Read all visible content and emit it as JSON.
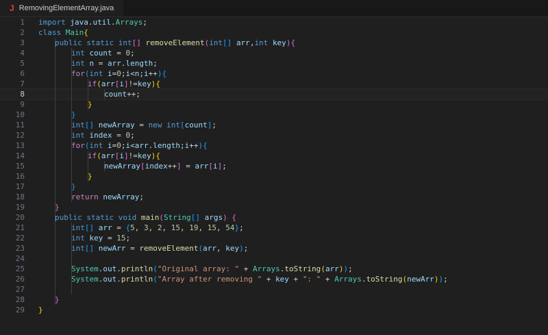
{
  "tab": {
    "icon": "java-icon",
    "label": "RemovingElementArray.java"
  },
  "active_line": 8,
  "colors": {
    "keyword": "#569cd6",
    "control": "#c586c0",
    "type": "#4ec9b0",
    "function": "#dcdcaa",
    "variable": "#9cdcfe",
    "number": "#b5cea8",
    "string": "#ce9178",
    "bracket1": "#ffd700",
    "bracket2": "#da70d6",
    "bracket3": "#179fff"
  },
  "lines": [
    {
      "n": "1",
      "ind": 0,
      "t": [
        [
          "kw",
          "import "
        ],
        [
          "var",
          "java"
        ],
        [
          "pl",
          "."
        ],
        [
          "var",
          "util"
        ],
        [
          "pl",
          "."
        ],
        [
          "ty",
          "Arrays"
        ],
        [
          "pl",
          ";"
        ]
      ]
    },
    {
      "n": "2",
      "ind": 0,
      "t": [
        [
          "kw",
          "class "
        ],
        [
          "ty",
          "Main"
        ],
        [
          "b1",
          "{"
        ]
      ]
    },
    {
      "n": "3",
      "ind": 1,
      "t": [
        [
          "kw",
          "public static int"
        ],
        [
          "b2",
          "[]"
        ],
        [
          "pl",
          " "
        ],
        [
          "fn",
          "removeElement"
        ],
        [
          "b2",
          "("
        ],
        [
          "kw",
          "int"
        ],
        [
          "b3",
          "[]"
        ],
        [
          "pl",
          " "
        ],
        [
          "var",
          "arr"
        ],
        [
          "pl",
          ","
        ],
        [
          "kw",
          "int"
        ],
        [
          "pl",
          " "
        ],
        [
          "var",
          "key"
        ],
        [
          "b2",
          ")"
        ],
        [
          "b2",
          "{"
        ]
      ]
    },
    {
      "n": "4",
      "ind": 2,
      "t": [
        [
          "kw",
          "int"
        ],
        [
          "pl",
          " "
        ],
        [
          "var",
          "count"
        ],
        [
          "pl",
          " = "
        ],
        [
          "num",
          "0"
        ],
        [
          "pl",
          ";"
        ]
      ]
    },
    {
      "n": "5",
      "ind": 2,
      "t": [
        [
          "kw",
          "int"
        ],
        [
          "pl",
          " "
        ],
        [
          "var",
          "n"
        ],
        [
          "pl",
          " = "
        ],
        [
          "var",
          "arr"
        ],
        [
          "pl",
          "."
        ],
        [
          "var",
          "length"
        ],
        [
          "pl",
          ";"
        ]
      ]
    },
    {
      "n": "6",
      "ind": 2,
      "t": [
        [
          "ctl",
          "for"
        ],
        [
          "b3",
          "("
        ],
        [
          "kw",
          "int"
        ],
        [
          "pl",
          " "
        ],
        [
          "var",
          "i"
        ],
        [
          "pl",
          "="
        ],
        [
          "num",
          "0"
        ],
        [
          "pl",
          ";"
        ],
        [
          "var",
          "i"
        ],
        [
          "pl",
          "<"
        ],
        [
          "var",
          "n"
        ],
        [
          "pl",
          ";"
        ],
        [
          "var",
          "i"
        ],
        [
          "pl",
          "++"
        ],
        [
          "b3",
          ")"
        ],
        [
          "b3",
          "{"
        ]
      ]
    },
    {
      "n": "7",
      "ind": 3,
      "t": [
        [
          "ctl",
          "if"
        ],
        [
          "b1",
          "("
        ],
        [
          "var",
          "arr"
        ],
        [
          "b2",
          "["
        ],
        [
          "var",
          "i"
        ],
        [
          "b2",
          "]"
        ],
        [
          "pl",
          "!="
        ],
        [
          "var",
          "key"
        ],
        [
          "b1",
          ")"
        ],
        [
          "b1",
          "{"
        ]
      ]
    },
    {
      "n": "8",
      "ind": 4,
      "t": [
        [
          "var",
          "count"
        ],
        [
          "pl",
          "++;"
        ]
      ]
    },
    {
      "n": "9",
      "ind": 3,
      "t": [
        [
          "b1",
          "}"
        ]
      ]
    },
    {
      "n": "10",
      "ind": 2,
      "t": [
        [
          "b3",
          "}"
        ]
      ]
    },
    {
      "n": "11",
      "ind": 2,
      "t": [
        [
          "kw",
          "int"
        ],
        [
          "b3",
          "[]"
        ],
        [
          "pl",
          " "
        ],
        [
          "var",
          "newArray"
        ],
        [
          "pl",
          " = "
        ],
        [
          "kw",
          "new int"
        ],
        [
          "b3",
          "["
        ],
        [
          "var",
          "count"
        ],
        [
          "b3",
          "]"
        ],
        [
          "pl",
          ";"
        ]
      ]
    },
    {
      "n": "12",
      "ind": 2,
      "t": [
        [
          "kw",
          "int"
        ],
        [
          "pl",
          " "
        ],
        [
          "var",
          "index"
        ],
        [
          "pl",
          " = "
        ],
        [
          "num",
          "0"
        ],
        [
          "pl",
          ";"
        ]
      ]
    },
    {
      "n": "13",
      "ind": 2,
      "t": [
        [
          "ctl",
          "for"
        ],
        [
          "b3",
          "("
        ],
        [
          "kw",
          "int"
        ],
        [
          "pl",
          " "
        ],
        [
          "var",
          "i"
        ],
        [
          "pl",
          "="
        ],
        [
          "num",
          "0"
        ],
        [
          "pl",
          ";"
        ],
        [
          "var",
          "i"
        ],
        [
          "pl",
          "<"
        ],
        [
          "var",
          "arr"
        ],
        [
          "pl",
          "."
        ],
        [
          "var",
          "length"
        ],
        [
          "pl",
          ";"
        ],
        [
          "var",
          "i"
        ],
        [
          "pl",
          "++"
        ],
        [
          "b3",
          ")"
        ],
        [
          "b3",
          "{"
        ]
      ]
    },
    {
      "n": "14",
      "ind": 3,
      "t": [
        [
          "ctl",
          "if"
        ],
        [
          "b1",
          "("
        ],
        [
          "var",
          "arr"
        ],
        [
          "b2",
          "["
        ],
        [
          "var",
          "i"
        ],
        [
          "b2",
          "]"
        ],
        [
          "pl",
          "!="
        ],
        [
          "var",
          "key"
        ],
        [
          "b1",
          ")"
        ],
        [
          "b1",
          "{"
        ]
      ]
    },
    {
      "n": "15",
      "ind": 4,
      "t": [
        [
          "var",
          "newArray"
        ],
        [
          "b2",
          "["
        ],
        [
          "var",
          "index"
        ],
        [
          "pl",
          "++"
        ],
        [
          "b2",
          "]"
        ],
        [
          "pl",
          " = "
        ],
        [
          "var",
          "arr"
        ],
        [
          "b2",
          "["
        ],
        [
          "var",
          "i"
        ],
        [
          "b2",
          "]"
        ],
        [
          "pl",
          ";"
        ]
      ]
    },
    {
      "n": "16",
      "ind": 3,
      "t": [
        [
          "b1",
          "}"
        ]
      ]
    },
    {
      "n": "17",
      "ind": 2,
      "t": [
        [
          "b3",
          "}"
        ]
      ]
    },
    {
      "n": "18",
      "ind": 2,
      "t": [
        [
          "ctl",
          "return"
        ],
        [
          "pl",
          " "
        ],
        [
          "var",
          "newArray"
        ],
        [
          "pl",
          ";"
        ]
      ]
    },
    {
      "n": "19",
      "ind": 1,
      "t": [
        [
          "b2",
          "}"
        ]
      ]
    },
    {
      "n": "20",
      "ind": 1,
      "t": [
        [
          "kw",
          "public static void"
        ],
        [
          "pl",
          " "
        ],
        [
          "fn",
          "main"
        ],
        [
          "b2",
          "("
        ],
        [
          "ty",
          "String"
        ],
        [
          "b3",
          "[]"
        ],
        [
          "pl",
          " "
        ],
        [
          "var",
          "args"
        ],
        [
          "b2",
          ")"
        ],
        [
          "pl",
          " "
        ],
        [
          "b2",
          "{"
        ]
      ]
    },
    {
      "n": "21",
      "ind": 2,
      "t": [
        [
          "kw",
          "int"
        ],
        [
          "b3",
          "[]"
        ],
        [
          "pl",
          " "
        ],
        [
          "var",
          "arr"
        ],
        [
          "pl",
          " = "
        ],
        [
          "b3",
          "{"
        ],
        [
          "num",
          "5"
        ],
        [
          "pl",
          ", "
        ],
        [
          "num",
          "3"
        ],
        [
          "pl",
          ", "
        ],
        [
          "num",
          "2"
        ],
        [
          "pl",
          ", "
        ],
        [
          "num",
          "15"
        ],
        [
          "pl",
          ", "
        ],
        [
          "num",
          "19"
        ],
        [
          "pl",
          ", "
        ],
        [
          "num",
          "15"
        ],
        [
          "pl",
          ", "
        ],
        [
          "num",
          "54"
        ],
        [
          "b3",
          "}"
        ],
        [
          "pl",
          ";"
        ]
      ]
    },
    {
      "n": "22",
      "ind": 2,
      "t": [
        [
          "kw",
          "int"
        ],
        [
          "pl",
          " "
        ],
        [
          "var",
          "key"
        ],
        [
          "pl",
          " = "
        ],
        [
          "num",
          "15"
        ],
        [
          "pl",
          ";"
        ]
      ]
    },
    {
      "n": "23",
      "ind": 2,
      "t": [
        [
          "kw",
          "int"
        ],
        [
          "b3",
          "[]"
        ],
        [
          "pl",
          " "
        ],
        [
          "var",
          "newArr"
        ],
        [
          "pl",
          " = "
        ],
        [
          "fn",
          "removeElement"
        ],
        [
          "b3",
          "("
        ],
        [
          "var",
          "arr"
        ],
        [
          "pl",
          ", "
        ],
        [
          "var",
          "key"
        ],
        [
          "b3",
          ")"
        ],
        [
          "pl",
          ";"
        ]
      ]
    },
    {
      "n": "24",
      "ind": 0,
      "t": []
    },
    {
      "n": "25",
      "ind": 2,
      "t": [
        [
          "ty",
          "System"
        ],
        [
          "pl",
          "."
        ],
        [
          "var",
          "out"
        ],
        [
          "pl",
          "."
        ],
        [
          "fn",
          "println"
        ],
        [
          "b3",
          "("
        ],
        [
          "str",
          "\"Original array: \""
        ],
        [
          "pl",
          " + "
        ],
        [
          "ty",
          "Arrays"
        ],
        [
          "pl",
          "."
        ],
        [
          "fn",
          "toString"
        ],
        [
          "b1",
          "("
        ],
        [
          "var",
          "arr"
        ],
        [
          "b1",
          ")"
        ],
        [
          "b3",
          ")"
        ],
        [
          "pl",
          ";"
        ]
      ]
    },
    {
      "n": "26",
      "ind": 2,
      "t": [
        [
          "ty",
          "System"
        ],
        [
          "pl",
          "."
        ],
        [
          "var",
          "out"
        ],
        [
          "pl",
          "."
        ],
        [
          "fn",
          "println"
        ],
        [
          "b3",
          "("
        ],
        [
          "str",
          "\"Array after removing \""
        ],
        [
          "pl",
          " + "
        ],
        [
          "var",
          "key"
        ],
        [
          "pl",
          " + "
        ],
        [
          "str",
          "\": \""
        ],
        [
          "pl",
          " + "
        ],
        [
          "ty",
          "Arrays"
        ],
        [
          "pl",
          "."
        ],
        [
          "fn",
          "toString"
        ],
        [
          "b1",
          "("
        ],
        [
          "var",
          "newArr"
        ],
        [
          "b1",
          ")"
        ],
        [
          "b3",
          ")"
        ],
        [
          "pl",
          ";"
        ]
      ]
    },
    {
      "n": "27",
      "ind": 0,
      "t": []
    },
    {
      "n": "28",
      "ind": 1,
      "t": [
        [
          "b2",
          "}"
        ]
      ]
    },
    {
      "n": "29",
      "ind": 0,
      "t": [
        [
          "b1",
          "}"
        ]
      ]
    }
  ]
}
